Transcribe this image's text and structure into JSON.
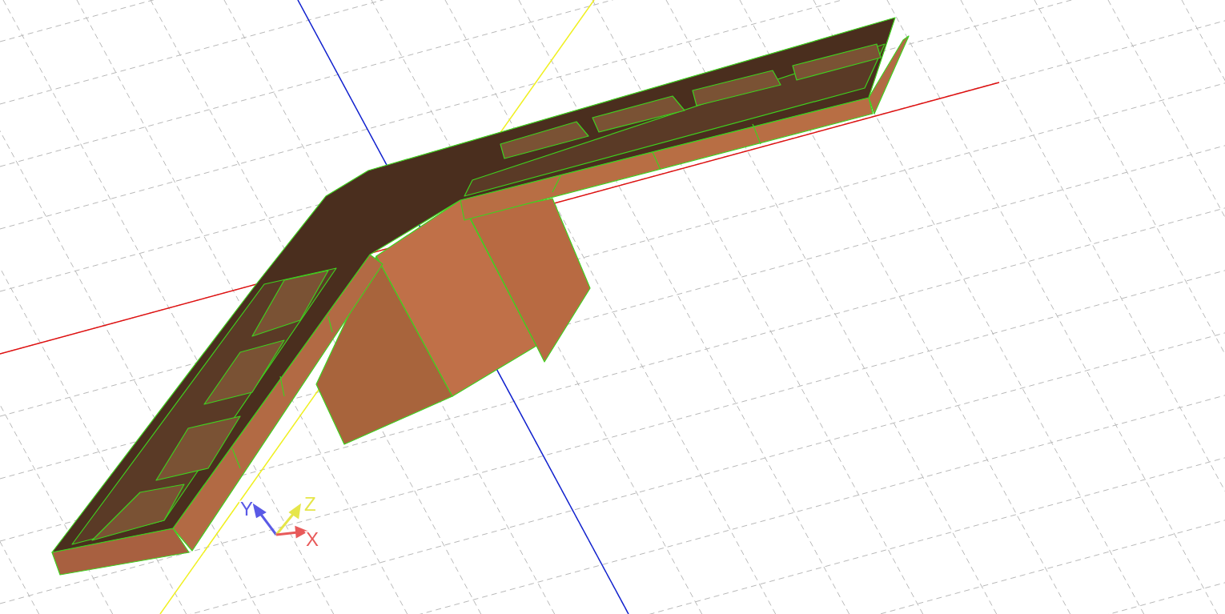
{
  "viewport": {
    "axis_labels": [
      {
        "text": "Y",
        "color": "#5a5ae6"
      },
      {
        "text": "Z",
        "color": "#e6e64a"
      },
      {
        "text": "X",
        "color": "#e85a5a"
      }
    ]
  }
}
